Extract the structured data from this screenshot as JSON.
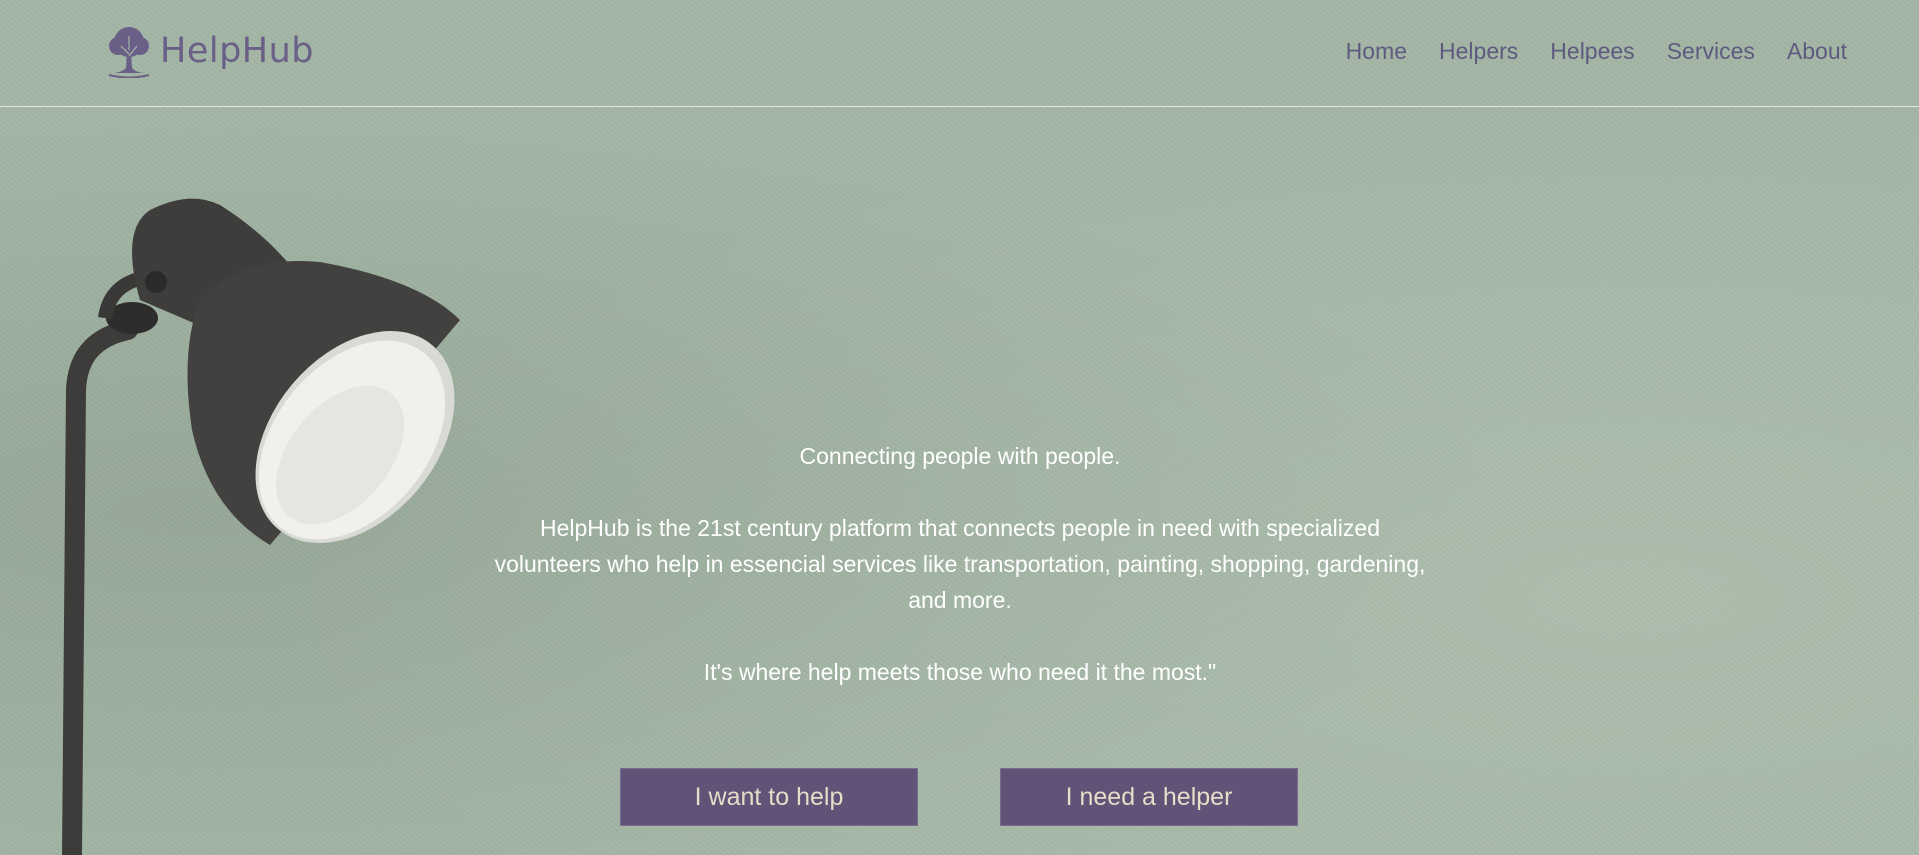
{
  "header": {
    "brand": "HelpHub",
    "logo_icon": "tree-icon",
    "nav": [
      {
        "label": "Home"
      },
      {
        "label": "Helpers"
      },
      {
        "label": "Helpees"
      },
      {
        "label": "Services"
      },
      {
        "label": "About"
      }
    ]
  },
  "hero": {
    "tagline": "Connecting people with people.",
    "description": "HelpHub is the 21st century platform that connects people in need with specialized volunteers who help in essencial services like transportation, painting, shopping, gardening, and more.",
    "closing": "It's where help meets those who need it the most.\""
  },
  "actions": {
    "want_to_help": "I want to help",
    "need_helper": "I need a helper"
  },
  "colors": {
    "background": "#a3b6a5",
    "accent": "#615277",
    "nav_text": "#5f5a80",
    "button_text": "#e6dcc8"
  },
  "decor": {
    "image_icon": "floor-lamp-icon"
  }
}
